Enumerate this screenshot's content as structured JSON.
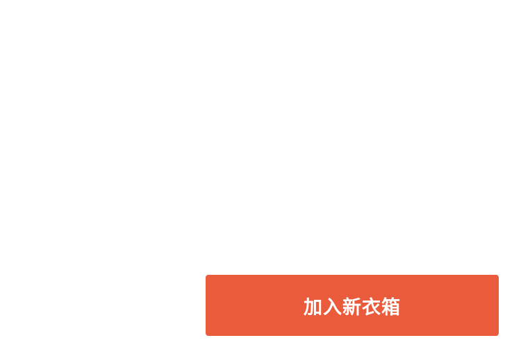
{
  "footer": {
    "add_button_label": "加入新衣箱"
  },
  "colors": {
    "accent": "#E95B3A",
    "background": "#FFFFFF",
    "button_text": "#FFFFFF"
  }
}
